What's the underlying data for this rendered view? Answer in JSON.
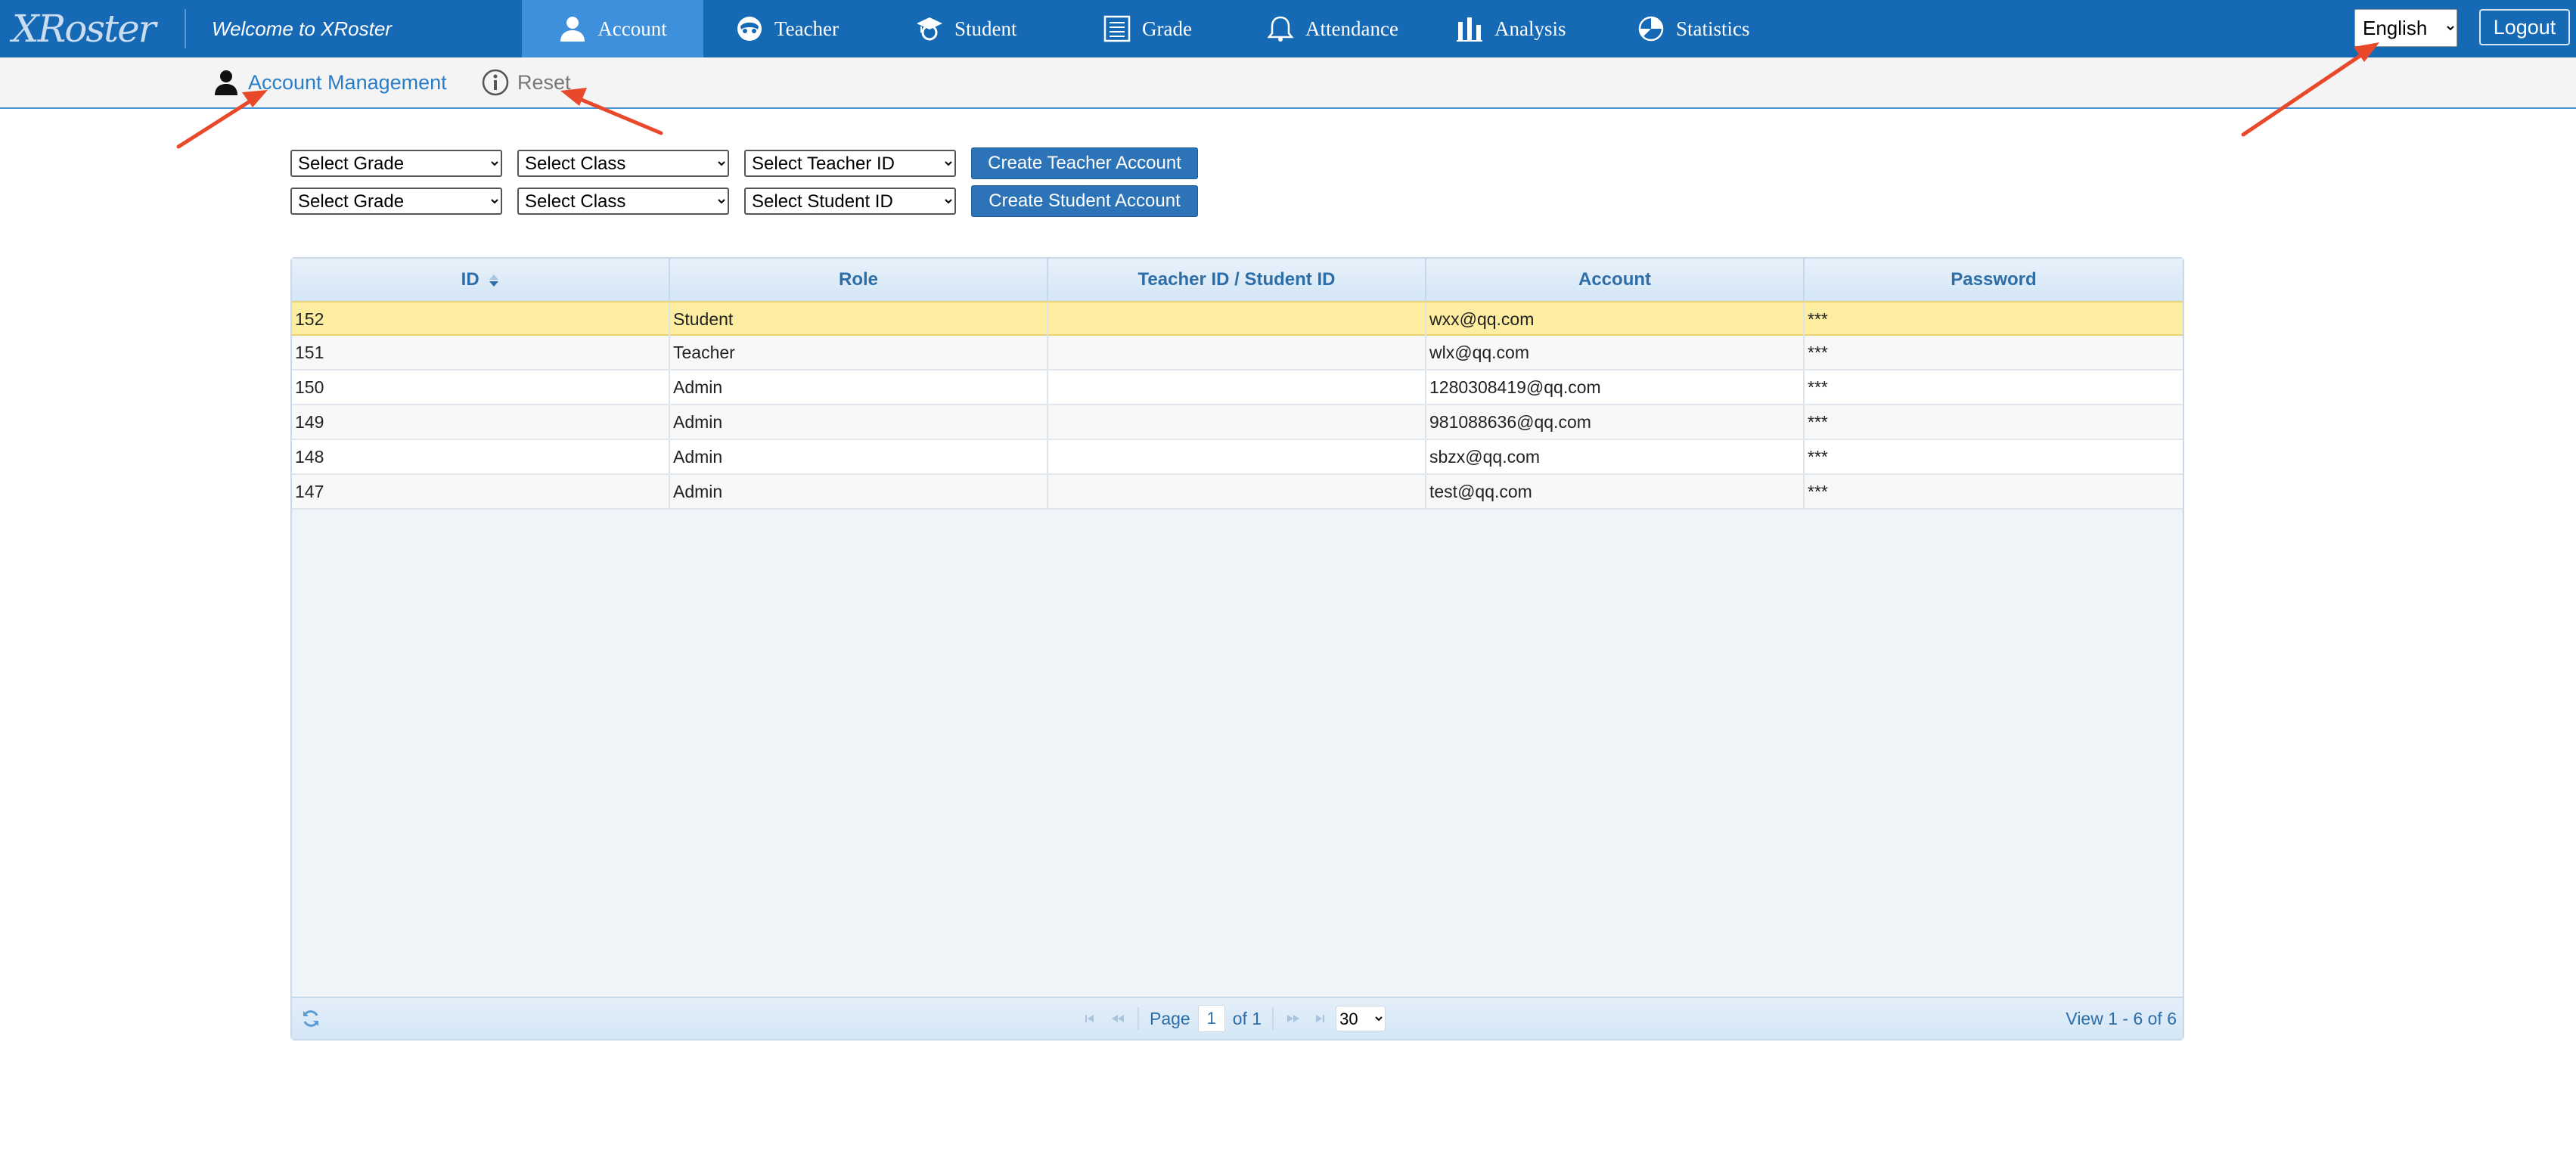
{
  "header": {
    "logo": "XRoster",
    "welcome": "Welcome to XRoster",
    "nav": [
      {
        "label": "Account",
        "icon": "user-icon",
        "active": true
      },
      {
        "label": "Teacher",
        "icon": "teacher-icon"
      },
      {
        "label": "Student",
        "icon": "student-cap-icon"
      },
      {
        "label": "Grade",
        "icon": "list-icon"
      },
      {
        "label": "Attendance",
        "icon": "bell-icon"
      },
      {
        "label": "Analysis",
        "icon": "bar-chart-icon"
      },
      {
        "label": "Statistics",
        "icon": "pie-chart-icon"
      }
    ],
    "language": {
      "selected": "English"
    },
    "logout_label": "Logout"
  },
  "subnav": {
    "account_management": "Account Management",
    "reset": "Reset"
  },
  "filters": {
    "teacher_row": {
      "grade": "Select Grade",
      "class": "Select Class",
      "id": "Select Teacher ID",
      "button": "Create Teacher Account"
    },
    "student_row": {
      "grade": "Select Grade",
      "class": "Select Class",
      "id": "Select Student ID",
      "button": "Create Student Account"
    }
  },
  "table": {
    "columns": [
      "ID",
      "Role",
      "Teacher ID / Student ID",
      "Account",
      "Password"
    ],
    "rows": [
      {
        "id": "152",
        "role": "Student",
        "tsid": "",
        "account": "wxx@qq.com",
        "password": "***",
        "selected": true
      },
      {
        "id": "151",
        "role": "Teacher",
        "tsid": "",
        "account": "wlx@qq.com",
        "password": "***"
      },
      {
        "id": "150",
        "role": "Admin",
        "tsid": "",
        "account": "1280308419@qq.com",
        "password": "***"
      },
      {
        "id": "149",
        "role": "Admin",
        "tsid": "",
        "account": "981088636@qq.com",
        "password": "***"
      },
      {
        "id": "148",
        "role": "Admin",
        "tsid": "",
        "account": "sbzx@qq.com",
        "password": "***"
      },
      {
        "id": "147",
        "role": "Admin",
        "tsid": "",
        "account": "test@qq.com",
        "password": "***"
      }
    ]
  },
  "pager": {
    "page_label": "Page",
    "page_value": "1",
    "of_label": "of 1",
    "rows_per_page": "30",
    "view_info": "View 1 - 6 of 6"
  },
  "colors": {
    "nav_bg": "#1569b5",
    "nav_active": "#3e8fdc",
    "highlight_row": "#fdeda0",
    "annotation_arrow": "#e8492a"
  }
}
